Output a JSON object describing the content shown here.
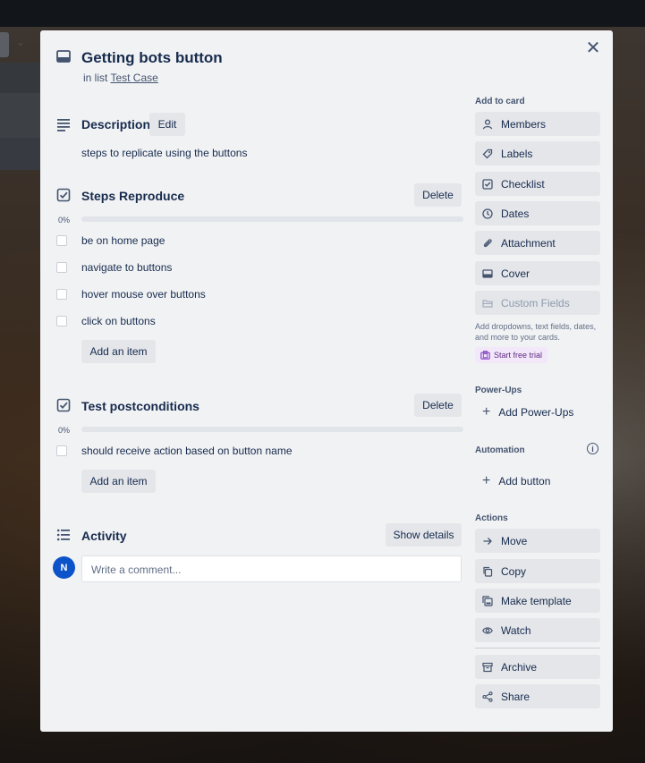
{
  "card": {
    "title": "Getting bots button",
    "in_list_prefix": "in list",
    "list_name": "Test Case"
  },
  "description": {
    "heading": "Description",
    "edit_label": "Edit",
    "text": "steps to replicate using the buttons"
  },
  "checklists": [
    {
      "title": "Steps Reproduce",
      "delete_label": "Delete",
      "progress_text": "0%",
      "progress": 0,
      "items": [
        {
          "label": "be on home page",
          "checked": false
        },
        {
          "label": "navigate to buttons",
          "checked": false
        },
        {
          "label": "hover mouse over buttons",
          "checked": false
        },
        {
          "label": "click on buttons",
          "checked": false
        }
      ],
      "add_item_label": "Add an item"
    },
    {
      "title": "Test postconditions",
      "delete_label": "Delete",
      "progress_text": "0%",
      "progress": 0,
      "items": [
        {
          "label": "should receive action based on button name",
          "checked": false
        }
      ],
      "add_item_label": "Add an item"
    }
  ],
  "activity": {
    "heading": "Activity",
    "show_details_label": "Show details",
    "avatar_initial": "N",
    "comment_placeholder": "Write a comment..."
  },
  "sidebar": {
    "add_to_card_heading": "Add to card",
    "add_to_card": [
      {
        "label": "Members",
        "icon": "person-icon"
      },
      {
        "label": "Labels",
        "icon": "tag-icon"
      },
      {
        "label": "Checklist",
        "icon": "checkbox-icon"
      },
      {
        "label": "Dates",
        "icon": "clock-icon"
      },
      {
        "label": "Attachment",
        "icon": "paperclip-icon"
      },
      {
        "label": "Cover",
        "icon": "cover-icon"
      },
      {
        "label": "Custom Fields",
        "icon": "folder-icon"
      }
    ],
    "custom_fields_note": "Add dropdowns, text fields, dates, and more to your cards.",
    "trial_label": "Start free trial",
    "powerups_heading": "Power-Ups",
    "add_powerups_label": "Add Power-Ups",
    "automation_heading": "Automation",
    "add_button_label": "Add button",
    "actions_heading": "Actions",
    "actions": [
      {
        "label": "Move",
        "icon": "arrow-right-icon"
      },
      {
        "label": "Copy",
        "icon": "copy-icon"
      },
      {
        "label": "Make template",
        "icon": "template-icon"
      },
      {
        "label": "Watch",
        "icon": "eye-icon"
      }
    ],
    "archive_label": "Archive",
    "share_label": "Share"
  },
  "colors": {
    "modal_bg": "#f1f2f4",
    "button_bg": "#e4e6ea",
    "text": "#172b4d",
    "avatar": "#0c53c9",
    "trial_bg": "#f3e8fa"
  }
}
